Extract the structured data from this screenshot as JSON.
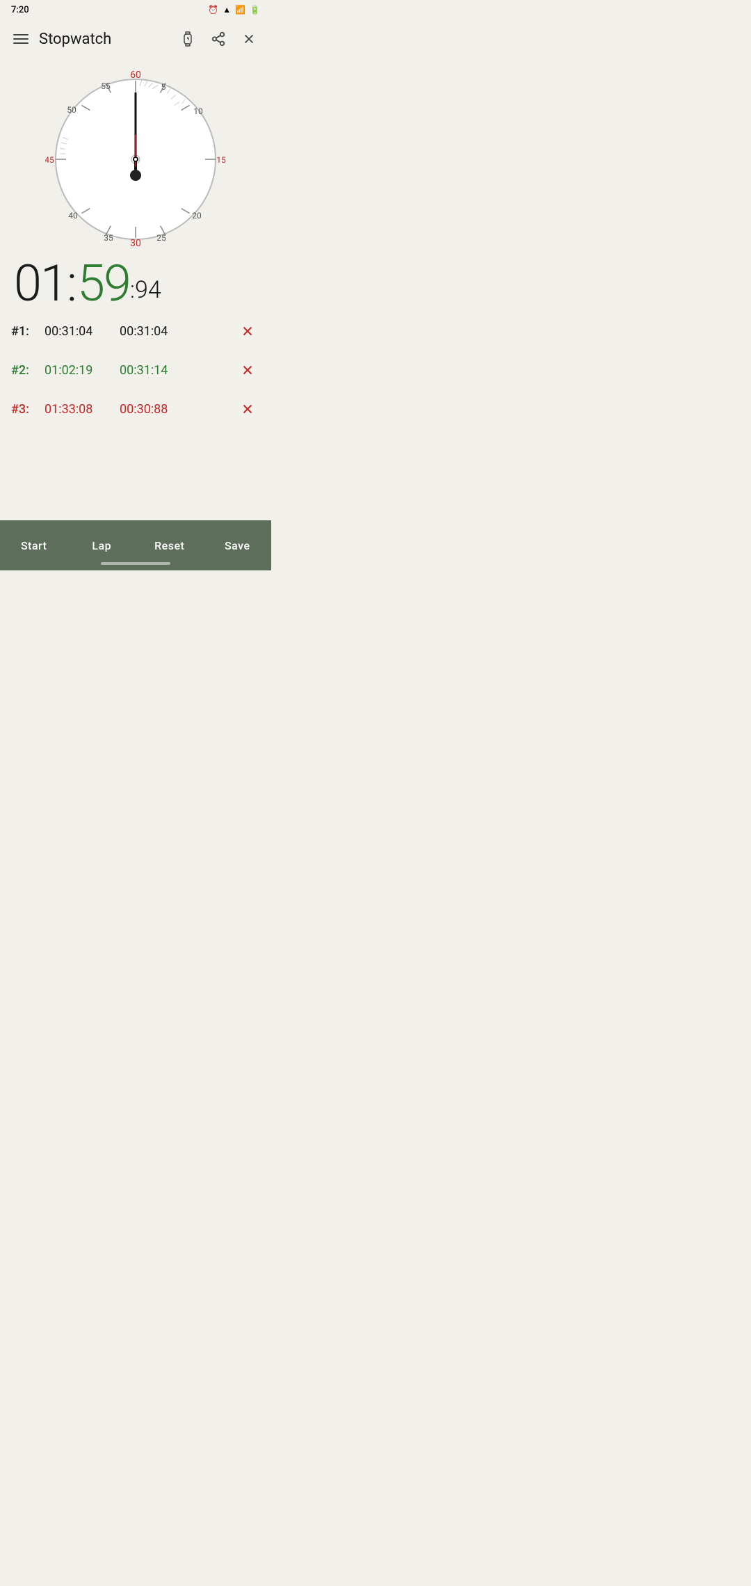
{
  "statusBar": {
    "time": "7:20",
    "alarmIcon": "⏰"
  },
  "topBar": {
    "title": "Stopwatch",
    "menuIcon": "menu-icon",
    "watchIcon": "watch-icon",
    "shareIcon": "share-icon",
    "closeIcon": "close-icon"
  },
  "digital": {
    "minutes": "01",
    "colon1": ":",
    "seconds": "59",
    "colon2": ":",
    "centiseconds": "94"
  },
  "laps": [
    {
      "num": "#1:",
      "total": "00:31:04",
      "split": "00:31:04",
      "colorClass": "row-black"
    },
    {
      "num": "#2:",
      "total": "01:02:19",
      "split": "00:31:14",
      "colorClass": "row-green"
    },
    {
      "num": "#3:",
      "total": "01:33:08",
      "split": "00:30:88",
      "colorClass": "row-red"
    }
  ],
  "bottomBar": {
    "start": "Start",
    "lap": "Lap",
    "reset": "Reset",
    "save": "Save"
  },
  "clock": {
    "label60": "60",
    "label5": "5",
    "label10": "10",
    "label15": "15",
    "label20": "20",
    "label25": "25",
    "label30": "30",
    "label35": "35",
    "label40": "40",
    "label45": "45",
    "label50": "50",
    "label55": "55"
  }
}
